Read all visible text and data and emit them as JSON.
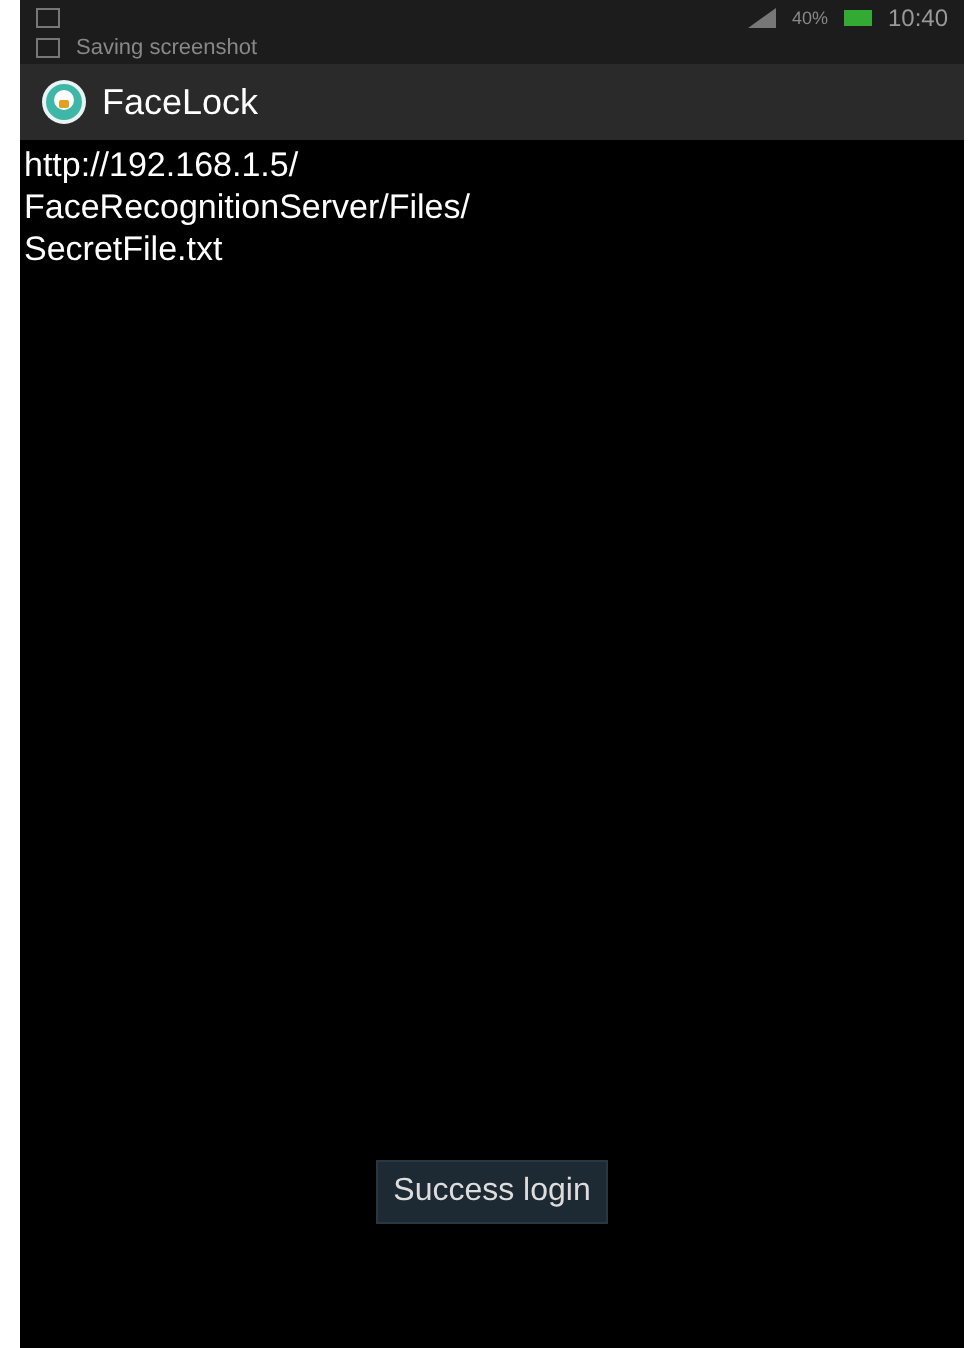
{
  "status_bar": {
    "notification": "Saving screenshot",
    "battery": "40%",
    "time": "10:40"
  },
  "action_bar": {
    "title": "FaceLock"
  },
  "content": {
    "url_lines": [
      "http://192.168.1.5/",
      "FaceRecognitionServer/Files/",
      "SecretFile.txt"
    ]
  },
  "toast": {
    "text": "Success login"
  }
}
